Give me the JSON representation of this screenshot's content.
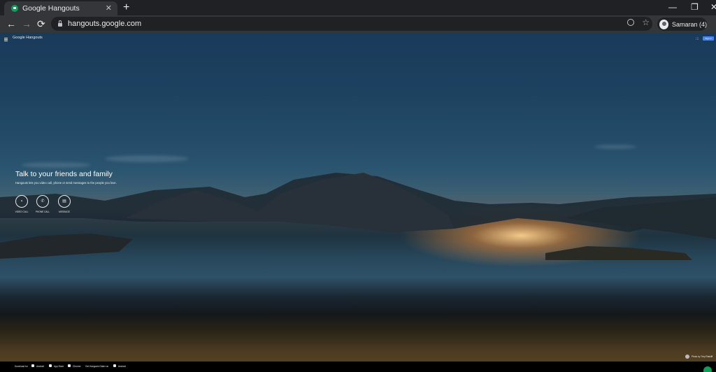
{
  "browser": {
    "tab_title": "Google Hangouts",
    "tab_close": "✕",
    "new_tab": "+",
    "url": "hangouts.google.com",
    "profile_name": "Samaran (4)",
    "nav": {
      "back": "←",
      "forward": "→",
      "reload": "⟳"
    },
    "window": {
      "minimize": "—",
      "restore": "❐",
      "close": "✕"
    },
    "star": "☆"
  },
  "page": {
    "logo": "Google Hangouts",
    "signin_label": "Sign in",
    "hero_title": "Talk to your friends and family",
    "hero_subtitle": "Hangouts lets you video call, phone or send messages to the people you love.",
    "actions": [
      {
        "label": "VIDEO CALL",
        "icon": "videocam-icon"
      },
      {
        "label": "PHONE CALL",
        "icon": "phone-icon"
      },
      {
        "label": "MESSAGE",
        "icon": "chat-icon"
      }
    ],
    "photo_credit": "Photo by Trey Ratcliff"
  },
  "footer": {
    "download_label": "Download for",
    "android_1": "Android",
    "app_store": "App Store",
    "chrome": "Chrome",
    "dialer_label": "Get Hangouts Dialer on",
    "android_2": "Android"
  },
  "colors": {
    "chrome_dark": "#202124",
    "chrome_tab": "#35363a",
    "hangouts_green": "#0f9d58",
    "signin_blue": "#4285f4"
  }
}
